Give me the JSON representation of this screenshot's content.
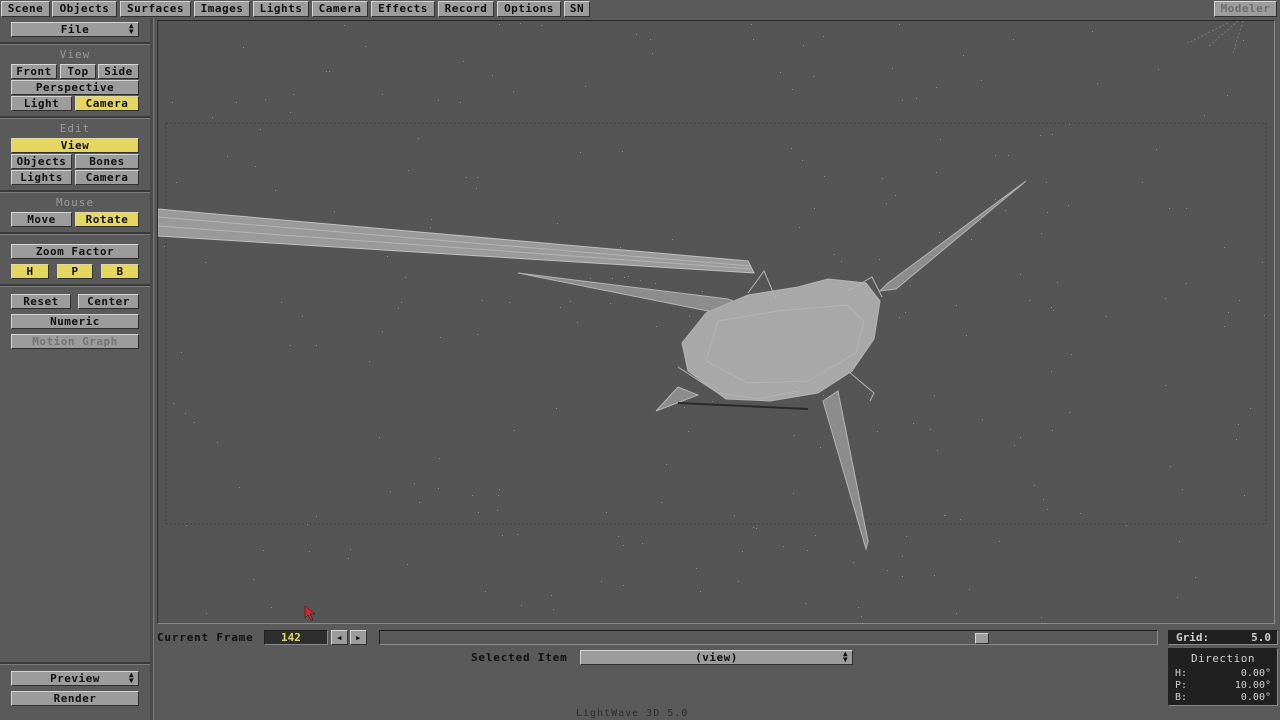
{
  "app": {
    "footer_title": "LightWave 3D 5.0"
  },
  "menubar": {
    "tabs": [
      {
        "label": "Scene"
      },
      {
        "label": "Objects"
      },
      {
        "label": "Surfaces"
      },
      {
        "label": "Images"
      },
      {
        "label": "Lights"
      },
      {
        "label": "Camera"
      },
      {
        "label": "Effects"
      },
      {
        "label": "Record"
      },
      {
        "label": "Options"
      },
      {
        "label": "SN"
      }
    ],
    "modeler_label": "Modeler"
  },
  "sidebar": {
    "file_label": "File",
    "view_header": "View",
    "view_buttons": {
      "front": "Front",
      "top": "Top",
      "side": "Side",
      "perspective": "Perspective",
      "light": "Light",
      "camera": "Camera"
    },
    "edit_header": "Edit",
    "edit_buttons": {
      "view": "View",
      "objects": "Objects",
      "bones": "Bones",
      "lights": "Lights",
      "camera": "Camera"
    },
    "mouse_header": "Mouse",
    "mouse_buttons": {
      "move": "Move",
      "rotate": "Rotate"
    },
    "zoom_factor": "Zoom Factor",
    "hpb": {
      "h": "H",
      "p": "P",
      "b": "B"
    },
    "reset": "Reset",
    "center": "Center",
    "numeric": "Numeric",
    "motion_graph": "Motion Graph",
    "preview": "Preview",
    "render": "Render",
    "active": {
      "view_mode": "Camera",
      "edit_mode": "View",
      "mouse_mode": "Rotate"
    }
  },
  "timeline": {
    "current_frame_label": "Current Frame",
    "current_frame": "142",
    "slider_position": 0.78
  },
  "selected_item": {
    "label": "Selected Item",
    "value": "(view)"
  },
  "grid": {
    "label": "Grid:",
    "value": "5.0"
  },
  "direction": {
    "title": "Direction",
    "h_label": "H:",
    "h_value": "0.00°",
    "p_label": "P:",
    "p_value": "10.00°",
    "b_label": "B:",
    "b_value": "0.00°"
  },
  "colors": {
    "panel": "#5a5a5a",
    "button": "#9c9c9c",
    "active_button": "#e4d65e",
    "wireframe": "#b4b4b4"
  }
}
